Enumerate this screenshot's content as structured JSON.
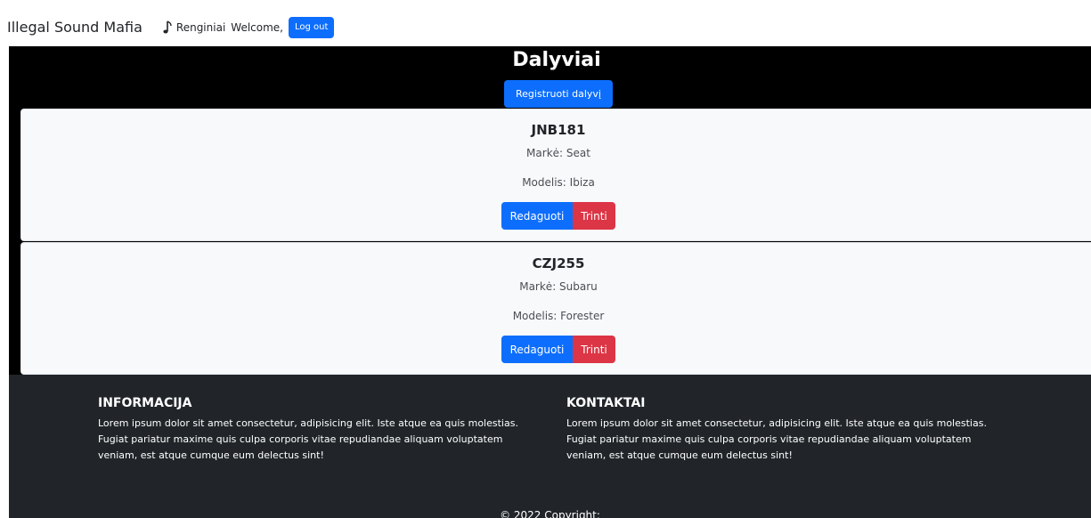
{
  "navbar": {
    "brand": "Illegal Sound Mafia",
    "events_label": "Renginiai",
    "welcome_text": "Welcome,",
    "logout_label": "Log out"
  },
  "main": {
    "title": "Dalyviai",
    "register_label": "Registruoti dalyvį",
    "participants": [
      {
        "plate": "JNB181",
        "brand_line": "Markė: Seat",
        "model_line": "Modelis: Ibiza",
        "edit_label": "Redaguoti",
        "delete_label": "Trinti"
      },
      {
        "plate": "CZJ255",
        "brand_line": "Markė: Subaru",
        "model_line": "Modelis: Forester",
        "edit_label": "Redaguoti",
        "delete_label": "Trinti"
      }
    ]
  },
  "footer": {
    "info_heading": "INFORMACIJA",
    "info_text": "Lorem ipsum dolor sit amet consectetur, adipisicing elit. Iste atque ea quis molestias. Fugiat pariatur maxime quis culpa corporis vitae repudiandae aliquam voluptatem veniam, est atque cumque eum delectus sint!",
    "contacts_heading": "KONTAKTAI",
    "contacts_text": "Lorem ipsum dolor sit amet consectetur, adipisicing elit. Iste atque ea quis molestias. Fugiat pariatur maxime quis culpa corporis vitae repudiandae aliquam voluptatem veniam, est atque cumque eum delectus sint!",
    "copyright": "© 2022 Copyright:"
  },
  "icons": {
    "events_icon": "music-note-icon"
  },
  "colors": {
    "primary": "#0d6efd",
    "danger": "#dc3545",
    "footer_bg": "#212529",
    "band_bg": "#000000",
    "card_bg": "#f8f9fa"
  }
}
